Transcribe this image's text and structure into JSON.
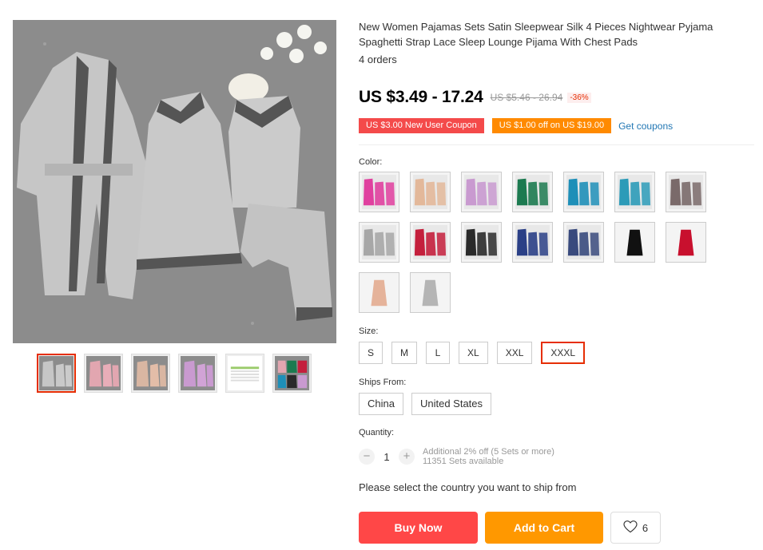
{
  "product": {
    "title": "New Women Pajamas Sets Satin Sleepwear Silk 4 Pieces Nightwear Pyjama Spaghetti Strap Lace Sleep Lounge Pijama With Chest Pads",
    "orders": "4 orders",
    "price": "US $3.49 - 17.24",
    "old_price": "US $5.46 - 26.94",
    "discount": "-36%"
  },
  "coupons": {
    "new_user": "US $3.00 New User Coupon",
    "off": "US $1.00 off on US $19.00",
    "link": "Get coupons"
  },
  "labels": {
    "color": "Color:",
    "size": "Size:",
    "ships_from": "Ships From:",
    "quantity": "Quantity:"
  },
  "colors": [
    "#e0409f",
    "#e3b89a",
    "#c99ad0",
    "#1c7a50",
    "#1e8fb8",
    "#2c9bb8",
    "#7a6a6a",
    "#a7a7a7",
    "#c41f3c",
    "#2a2a2a",
    "#2a3f86",
    "#394a7d",
    "#111111",
    "#c8102e",
    "#e5b39a",
    "#b5b5b5"
  ],
  "sizes": [
    "S",
    "M",
    "L",
    "XL",
    "XXL",
    "XXXL"
  ],
  "selected_size": "XXXL",
  "ships_from": [
    "China",
    "United States"
  ],
  "quantity": {
    "minus": "−",
    "value": "1",
    "plus": "+",
    "note": "Additional 2% off (5 Sets or more)",
    "available": "11351 Sets available"
  },
  "ship_note": "Please select the country you want to ship from",
  "actions": {
    "buy": "Buy Now",
    "cart": "Add to Cart",
    "wishlist_count": "6"
  }
}
